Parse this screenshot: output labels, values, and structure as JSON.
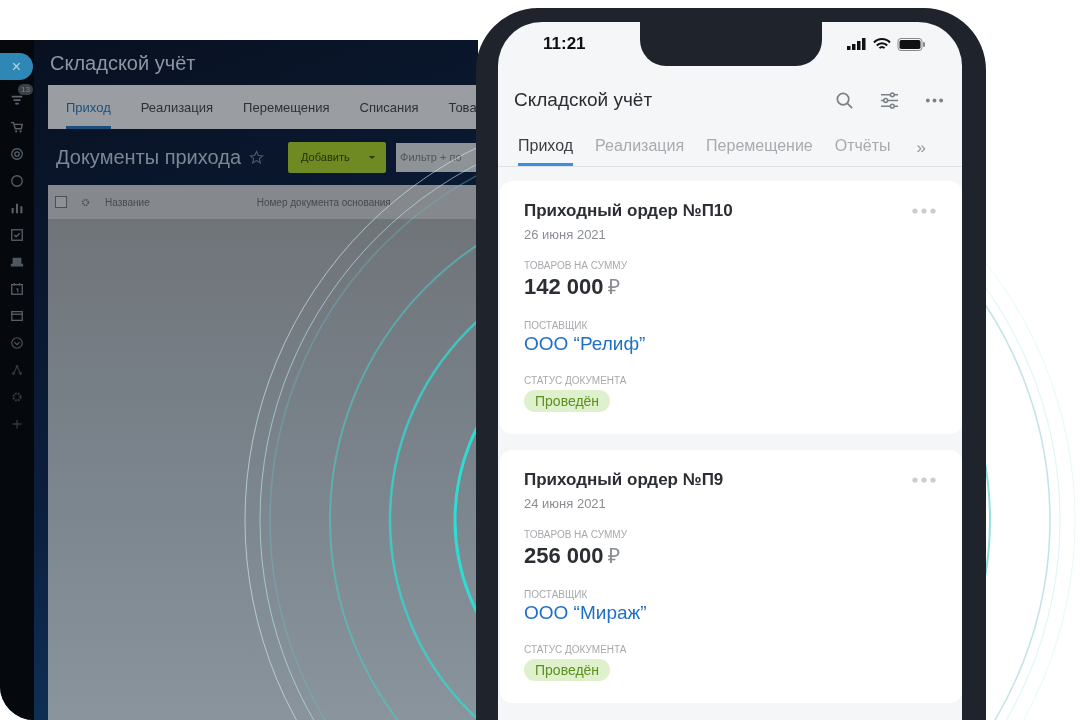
{
  "desktop": {
    "close_button": "×",
    "badge": "13",
    "title": "Складской учёт",
    "tabs": [
      {
        "label": "Приход",
        "selected": true
      },
      {
        "label": "Реализация",
        "selected": false
      },
      {
        "label": "Перемещения",
        "selected": false
      },
      {
        "label": "Списания",
        "selected": false
      },
      {
        "label": "Това",
        "selected": false
      }
    ],
    "page_title": "Документы прихода",
    "add_button": "Добавить",
    "filter": {
      "placeholder": "Фильтр + по"
    },
    "table": {
      "select_all_checked": false,
      "columns": [
        "Название",
        "Номер документа основания"
      ]
    }
  },
  "phone": {
    "time": "11:21",
    "title": "Складской учёт",
    "tabs": [
      {
        "label": "Приход",
        "selected": true
      },
      {
        "label": "Реализация",
        "selected": false
      },
      {
        "label": "Перемещение",
        "selected": false
      },
      {
        "label": "Отчёты",
        "selected": false
      }
    ],
    "more_tabs": "»",
    "cards": [
      {
        "title": "Приходный ордер №П10",
        "date": "26 июня 2021",
        "amount_label": "ТОВАРОВ НА СУММУ",
        "amount": "142 000",
        "currency": "₽",
        "supplier_label": "ПОСТАВЩИК",
        "supplier": "ООО “Релиф”",
        "status_label": "СТАТУС ДОКУМЕНТА",
        "status": "Проведён"
      },
      {
        "title": "Приходный ордер №П9",
        "date": "24 июня 2021",
        "amount_label": "ТОВАРОВ НА СУММУ",
        "amount": "256 000",
        "currency": "₽",
        "supplier_label": "ПОСТАВЩИК",
        "supplier": "ООО “Мираж”",
        "status_label": "СТАТУС ДОКУМЕНТА",
        "status": "Проведён"
      }
    ]
  }
}
